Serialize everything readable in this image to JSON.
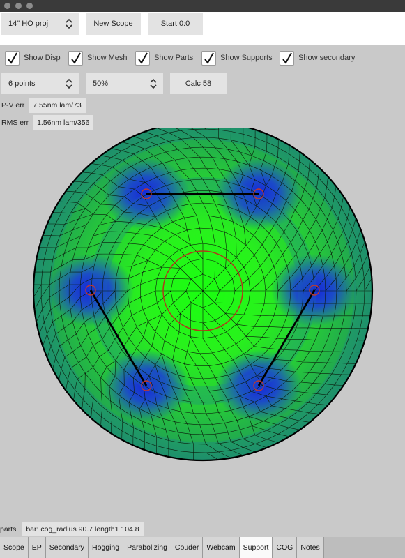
{
  "toolbar": {
    "scope_select": "14\" HO proj",
    "new_scope_label": "New Scope",
    "start_label": "Start 0:0"
  },
  "checkboxes": [
    {
      "label": "Show Disp",
      "checked": true
    },
    {
      "label": "Show Mesh",
      "checked": true
    },
    {
      "label": "Show Parts",
      "checked": true
    },
    {
      "label": "Show Supports",
      "checked": true
    },
    {
      "label": "Show secondary",
      "checked": true
    }
  ],
  "controls": {
    "points_select": "6 points",
    "percent_select": "50%",
    "calc_label": "Calc 58"
  },
  "stats": {
    "pv_label": "P-V err",
    "pv_value": "7.55nm lam/73",
    "rms_label": "RMS err",
    "rms_value": "1.56nm lam/356"
  },
  "parts": {
    "label": "parts",
    "value": "bar: cog_radius 90.7 length1 104.8"
  },
  "tabs": [
    "Scope",
    "EP",
    "Secondary",
    "Hogging",
    "Parabolizing",
    "Couder",
    "Webcam",
    "Support",
    "COG",
    "Notes"
  ],
  "active_tab": "Support",
  "colors": {
    "green": "#22ee22",
    "blue": "#1a22dd",
    "support_ring": "#c0392b",
    "mesh": "#000000"
  }
}
